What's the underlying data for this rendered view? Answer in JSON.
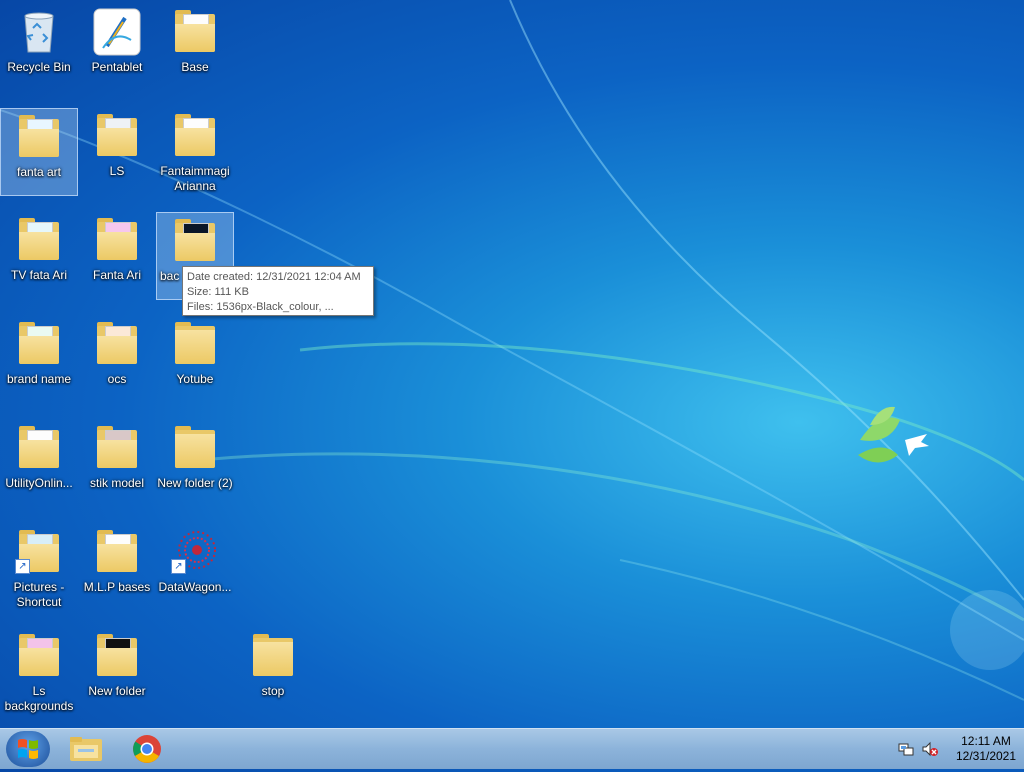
{
  "desktop": {
    "icons": [
      {
        "label": "Recycle Bin",
        "type": "recycle"
      },
      {
        "label": "Pentablet",
        "type": "app"
      },
      {
        "label": "Base",
        "type": "folder"
      },
      {
        "label": "fanta art",
        "type": "folder",
        "selected": true
      },
      {
        "label": "LS",
        "type": "folder"
      },
      {
        "label": "Fantaimmagi Arianna",
        "type": "folder"
      },
      {
        "label": "TV  fata Ari",
        "type": "folder"
      },
      {
        "label": "Fanta Ari",
        "type": "folder"
      },
      {
        "label": "bac",
        "type": "folder-dark",
        "selected": true
      },
      {
        "label": "brand name",
        "type": "folder"
      },
      {
        "label": "ocs",
        "type": "folder"
      },
      {
        "label": "Yotube",
        "type": "folder"
      },
      {
        "label": "UtilityOnlin...",
        "type": "folder"
      },
      {
        "label": "stik  model",
        "type": "folder"
      },
      {
        "label": "New folder (2)",
        "type": "folder"
      },
      {
        "label": "Pictures - Shortcut",
        "type": "folder-shortcut"
      },
      {
        "label": "M.L.P bases",
        "type": "folder"
      },
      {
        "label": "DataWagon...",
        "type": "app-shortcut"
      },
      {
        "label": "Ls backgrounds",
        "type": "folder"
      },
      {
        "label": "New folder",
        "type": "folder"
      },
      {
        "label": "stop",
        "type": "folder"
      }
    ]
  },
  "tooltip": {
    "date_created": "Date created: 12/31/2021 12:04 AM",
    "size": "Size: 111 KB",
    "files": "Files: 1536px-Black_colour, ..."
  },
  "taskbar": {
    "start_icon": "windows-logo-icon",
    "pinned": [
      {
        "name": "file-explorer-icon"
      },
      {
        "name": "chrome-icon"
      }
    ],
    "tray": {
      "network_icon": "network-icon",
      "volume_icon": "volume-muted-icon"
    },
    "clock": {
      "time": "12:11 AM",
      "date": "12/31/2021"
    }
  },
  "colors": {
    "desktop_blue": "#0c63c4",
    "taskbar": "#8cb3da",
    "folder_yellow": "#ecc964"
  }
}
